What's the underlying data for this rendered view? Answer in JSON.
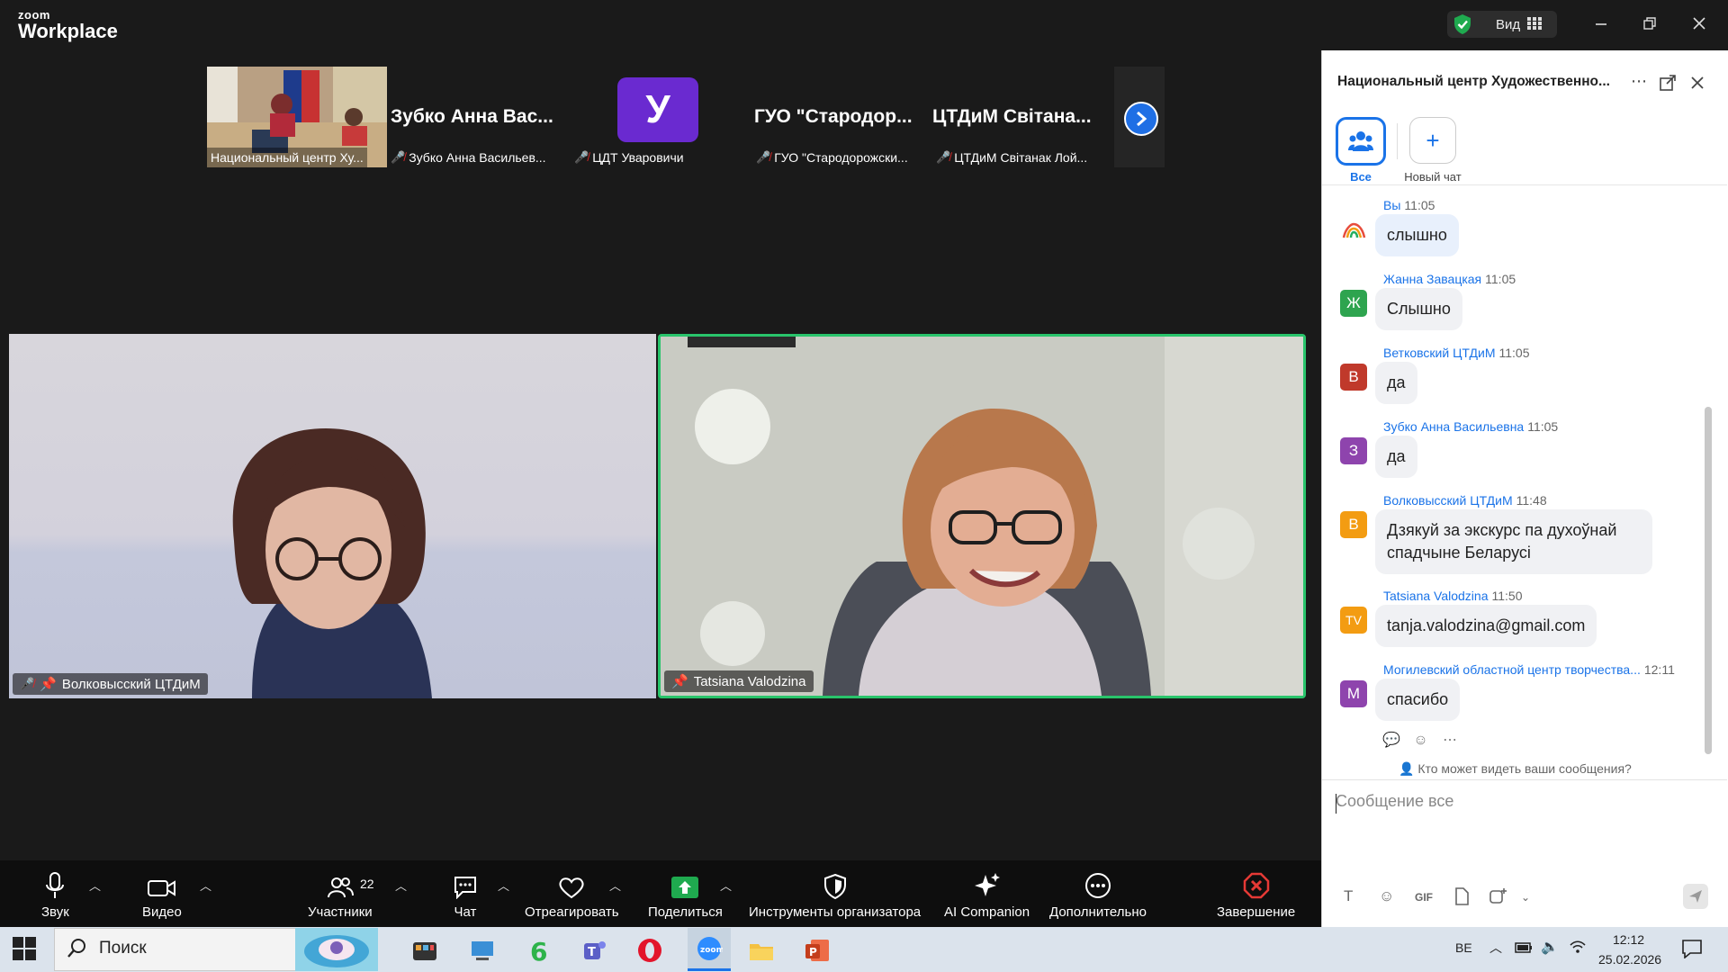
{
  "app": {
    "logo_small": "zoom",
    "logo_big": "Workplace",
    "view_label": "Вид"
  },
  "strip": {
    "tiles": [
      {
        "label": "Национальный центр Ху..."
      },
      {
        "name": "Зубко Анна Вас...",
        "label": "Зубко Анна Васильев..."
      },
      {
        "initial": "У",
        "label": "ЦДТ Уваровичи"
      },
      {
        "name": "ГУО \"Стародор...",
        "label": "ГУО \"Стародорожски..."
      },
      {
        "name": "ЦТДиМ Світана...",
        "label": "ЦТДиМ Світанак Лой..."
      }
    ]
  },
  "videos": {
    "left_label": "Волковысский ЦТДиМ",
    "right_label": "Tatsiana Valodzina"
  },
  "toolbar": {
    "audio": "Звук",
    "video": "Видео",
    "participants": "Участники",
    "participants_count": "22",
    "chat": "Чат",
    "react": "Отреагировать",
    "share": "Поделиться",
    "host_tools": "Инструменты организатора",
    "ai": "AI Companion",
    "more": "Дополнительно",
    "end": "Завершение"
  },
  "chat": {
    "title": "Национальный центр Художественно...",
    "tab_all": "Все",
    "tab_new": "Новый чат",
    "messages": [
      {
        "sender": "Вы",
        "time": "11:05",
        "text": "слышно",
        "initial": "",
        "color": "#ffffff"
      },
      {
        "sender": "Жанна Завацкая",
        "time": "11:05",
        "text": "Слышно",
        "initial": "Ж",
        "color": "#2ea44f"
      },
      {
        "sender": "Ветковский ЦТДиМ",
        "time": "11:05",
        "text": "да",
        "initial": "В",
        "color": "#c0392b"
      },
      {
        "sender": "Зубко Анна Васильевна",
        "time": "11:05",
        "text": "да",
        "initial": "З",
        "color": "#8e44ad"
      },
      {
        "sender": "Волковысский ЦТДиМ",
        "time": "11:48",
        "text_line1": "Дзякуй за экскурс па духоўнай",
        "text_line2": "спадчыне Беларусі",
        "initial": "В",
        "color": "#f39c12"
      },
      {
        "sender": "Tatsiana Valodzina",
        "time": "11:50",
        "text": "tanja.valodzina@gmail.com",
        "initial": "TV",
        "color": "#f39c12"
      },
      {
        "sender": "Могилевский областной центр творчества...",
        "time": "12:11",
        "text": "спасибо",
        "initial": "М",
        "color": "#8e44ad"
      }
    ],
    "who_sees": "Кто может видеть ваши сообщения?",
    "composer_placeholder": "Сообщение все",
    "gif": "GIF"
  },
  "taskbar": {
    "search": "Поиск",
    "lang": "BE",
    "time": "12:12",
    "date": "25.02.2026"
  }
}
